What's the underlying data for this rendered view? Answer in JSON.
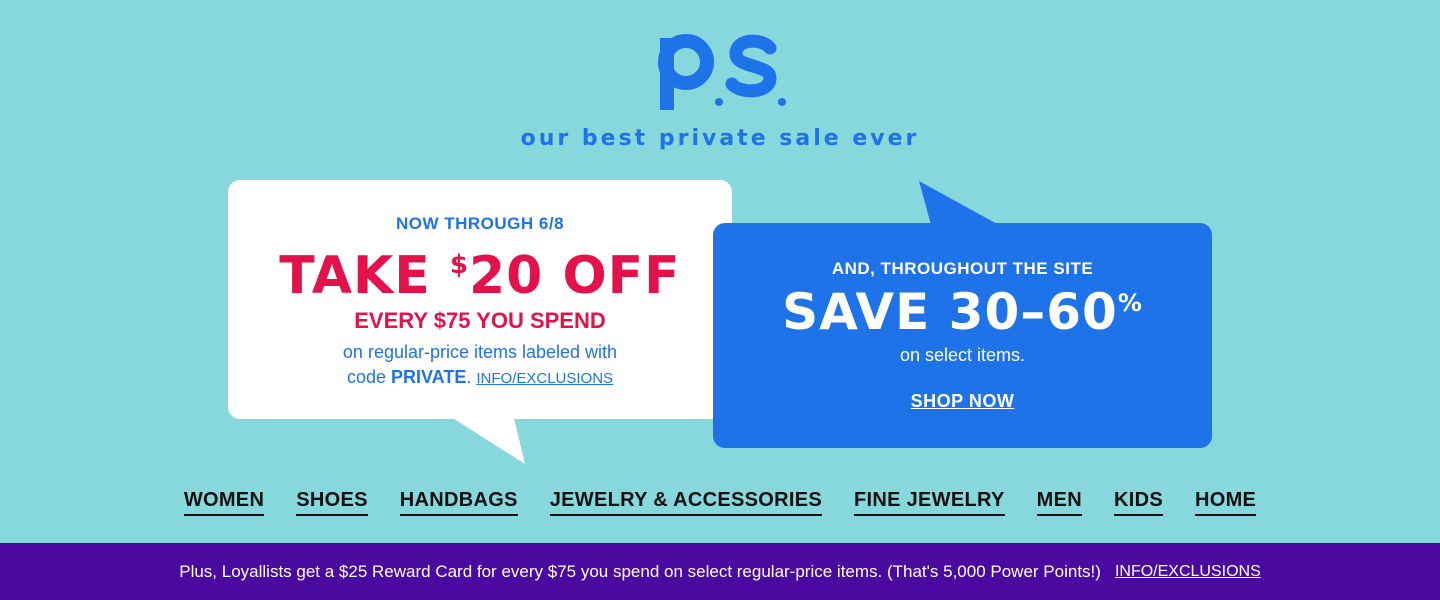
{
  "logo": {
    "text": "p.s."
  },
  "tagline": "our best private sale ever",
  "offer_left": {
    "kicker": "NOW THROUGH 6/8",
    "headline_prefix": "TAKE ",
    "headline_currency": "$",
    "headline_amount": "20 OFF",
    "subhead": "EVERY $75 YOU SPEND",
    "body_line1": "on regular-price items labeled with",
    "body_code_prefix": "code ",
    "body_code": "PRIVATE",
    "body_code_suffix": ".",
    "link": "INFO/EXCLUSIONS"
  },
  "offer_right": {
    "kicker": "AND, THROUGHOUT THE SITE",
    "headline": "SAVE 30–60",
    "headline_percent": "%",
    "body": "on select items.",
    "cta": "SHOP NOW"
  },
  "nav": {
    "items": [
      "WOMEN",
      "SHOES",
      "HANDBAGS",
      "JEWELRY & ACCESSORIES",
      "FINE JEWELRY",
      "MEN",
      "KIDS",
      "HOME"
    ]
  },
  "bottom_bar": {
    "text": "Plus, Loyallists get a $25 Reward Card for every $75 you spend on select regular-price items. (That's 5,000 Power Points!)",
    "link": "INFO/EXCLUSIONS"
  },
  "colors": {
    "background": "#86d8dd",
    "brand_blue": "#1e73e8",
    "accent_red": "#e4124a",
    "bar_purple": "#4a0aa0"
  }
}
